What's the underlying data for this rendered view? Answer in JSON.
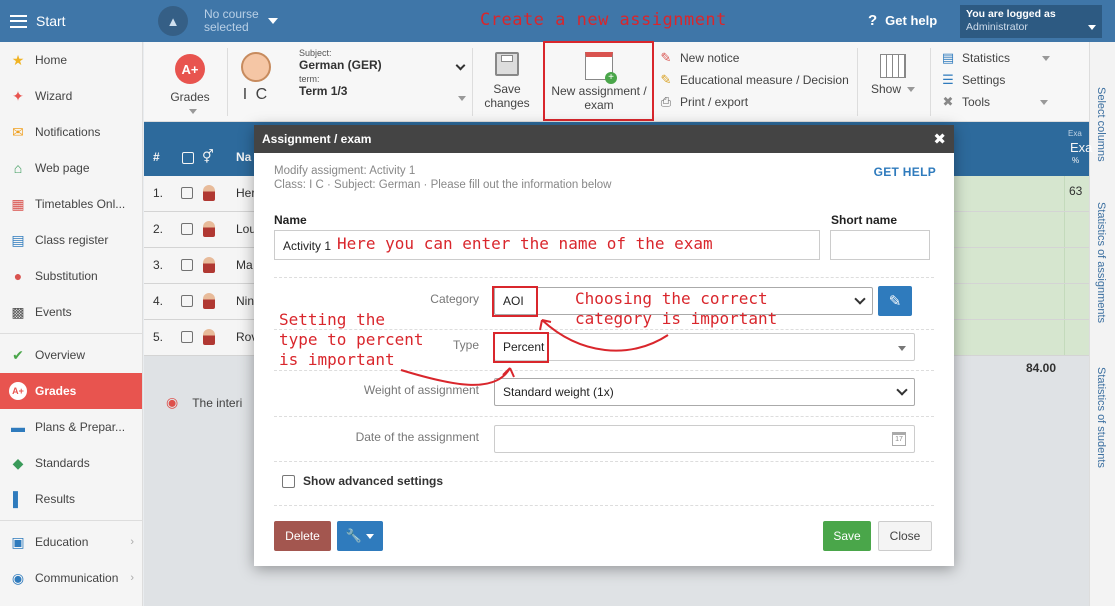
{
  "topbar": {
    "start_label": "Start",
    "course_label": "No course selected",
    "annotation": "Create a new assignment",
    "get_help": "Get help",
    "logged_in_label": "You are logged as",
    "user": "Administrator"
  },
  "sidebar": {
    "items": [
      {
        "label": "Home",
        "icon": "star-icon"
      },
      {
        "label": "Wizard",
        "icon": "wand-icon"
      },
      {
        "label": "Notifications",
        "icon": "envelope-icon"
      },
      {
        "label": "Web page",
        "icon": "home-icon"
      },
      {
        "label": "Timetables Onl...",
        "icon": "timetable-icon"
      },
      {
        "label": "Class register",
        "icon": "register-icon"
      },
      {
        "label": "Substitution",
        "icon": "person-icon"
      },
      {
        "label": "Events",
        "icon": "calendar-icon"
      },
      {
        "label": "Overview",
        "icon": "check-icon"
      },
      {
        "label": "Grades",
        "icon": "grades-icon"
      },
      {
        "label": "Plans & Prepar...",
        "icon": "plans-icon"
      },
      {
        "label": "Standards",
        "icon": "shield-icon"
      },
      {
        "label": "Results",
        "icon": "bar-chart-icon"
      },
      {
        "label": "Education",
        "icon": "book-icon"
      },
      {
        "label": "Communication",
        "icon": "chat-icon"
      }
    ]
  },
  "toolbar": {
    "grades_label": "Grades",
    "grades_badge": "A+",
    "class_label": "I C",
    "subject_label": "Subject:",
    "subject_value": "German (GER)",
    "term_label": "term:",
    "term_value": "Term 1/3",
    "save_label": "Save changes",
    "new_assignment_label": "New assignment / exam",
    "new_notice": "New notice",
    "educational_measure": "Educational measure / Decision",
    "print_export": "Print / export",
    "show_label": "Show",
    "statistics": "Statistics",
    "settings": "Settings",
    "tools": "Tools"
  },
  "rightpanel": {
    "select_columns": "Select columns",
    "stats_assignments": "Statistics of assignments",
    "stats_students": "Statistics of students"
  },
  "grid": {
    "col_num": "#",
    "col_name": "Na",
    "col_exam_small": "Exa",
    "col_exam": "Exa",
    "col_percent": "%",
    "rows": [
      {
        "num": "1.",
        "name": "Her"
      },
      {
        "num": "2.",
        "name": "Lou"
      },
      {
        "num": "3.",
        "name": "Ma"
      },
      {
        "num": "4.",
        "name": "Nin"
      },
      {
        "num": "5.",
        "name": "Rov"
      }
    ],
    "first_value": "63",
    "total": "84.00",
    "interim_text": "The interi"
  },
  "modal": {
    "title": "Assignment / exam",
    "subtitle1": "Modify assigment: Activity 1",
    "subtitle2": "Class: I C · Subject: German · Please fill out the information below",
    "get_help": "GET HELP",
    "name_label": "Name",
    "short_name_label": "Short name",
    "name_value": "Activity 1",
    "short_name_value": "",
    "category_label": "Category",
    "category_value": "AOI",
    "type_label": "Type",
    "type_value": "Percent",
    "weight_label": "Weight of assignment",
    "weight_value": "Standard weight (1x)",
    "date_label": "Date of the assignment",
    "date_value": "",
    "advanced_label": "Show advanced settings",
    "delete_label": "Delete",
    "save_label": "Save",
    "close_label": "Close"
  },
  "annotations": {
    "name_hint": "Here you can enter the name of the exam",
    "category_hint_1": "Choosing the correct",
    "category_hint_2": "category is important",
    "type_hint_1": "Setting the",
    "type_hint_2": "type to percent",
    "type_hint_3": "is important"
  },
  "colors": {
    "primary": "#3f76a8",
    "active": "#e8544f",
    "annotation": "#d9262c",
    "save": "#4aa64a",
    "delete": "#a3564f"
  }
}
